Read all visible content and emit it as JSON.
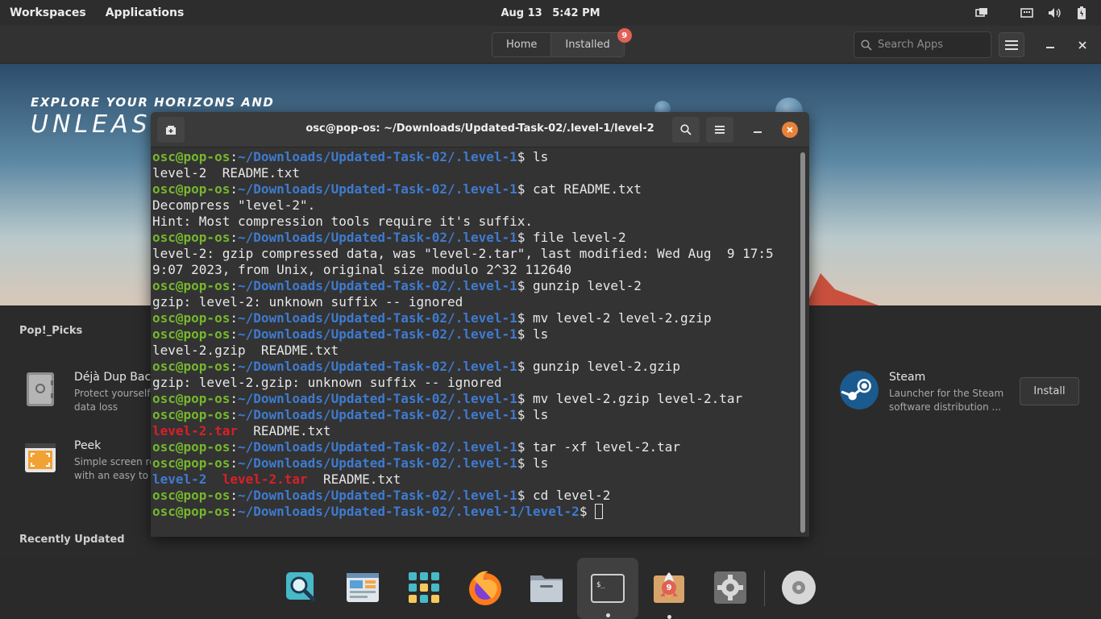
{
  "topbar": {
    "workspaces": "Workspaces",
    "applications": "Applications",
    "date": "Aug 13",
    "time": "5:42 PM"
  },
  "header": {
    "tabs": [
      {
        "label": "Home"
      },
      {
        "label": "Installed",
        "badge": "9"
      }
    ],
    "search_placeholder": "Search Apps"
  },
  "banner": {
    "line1": "EXPLORE YOUR HORIZONS AND",
    "line2": "UNLEASH"
  },
  "sections": {
    "picks_title": "Pop!_Picks",
    "recent_title": "Recently Updated"
  },
  "apps": [
    {
      "name": "Déjà Dup Backu",
      "desc_line1": "Protect yourself",
      "desc_line2": "data loss"
    },
    {
      "name": "Peek",
      "desc_line1": "Simple screen re",
      "desc_line2": "with an easy to u"
    },
    {
      "name": "Steam",
      "desc_line1": "Launcher for the Steam",
      "desc_line2": "software distribution ...",
      "action": "Install"
    }
  ],
  "terminal": {
    "title": "osc@pop-os: ~/Downloads/Updated-Task-02/.level-1/level-2",
    "user": "osc@pop-os",
    "cwd": "~/Downloads/Updated-Task-02/.level-1",
    "cwd_final": "~/Downloads/Updated-Task-02/.level-1/level-2",
    "lines": [
      {
        "type": "prompt",
        "cmd": "ls"
      },
      {
        "type": "out",
        "text": "level-2  README.txt"
      },
      {
        "type": "prompt",
        "cmd": "cat README.txt"
      },
      {
        "type": "out",
        "text": "Decompress \"level-2\"."
      },
      {
        "type": "out",
        "text": "Hint: Most compression tools require it's suffix."
      },
      {
        "type": "prompt",
        "cmd": "file level-2"
      },
      {
        "type": "out",
        "text": "level-2: gzip compressed data, was \"level-2.tar\", last modified: Wed Aug  9 17:5"
      },
      {
        "type": "out",
        "text": "9:07 2023, from Unix, original size modulo 2^32 112640"
      },
      {
        "type": "prompt",
        "cmd": "gunzip level-2"
      },
      {
        "type": "out",
        "text": "gzip: level-2: unknown suffix -- ignored"
      },
      {
        "type": "prompt",
        "cmd": "mv level-2 level-2.gzip"
      },
      {
        "type": "prompt",
        "cmd": "ls"
      },
      {
        "type": "out",
        "text": "level-2.gzip  README.txt"
      },
      {
        "type": "prompt",
        "cmd": "gunzip level-2.gzip"
      },
      {
        "type": "out",
        "text": "gzip: level-2.gzip: unknown suffix -- ignored"
      },
      {
        "type": "prompt",
        "cmd": "mv level-2.gzip level-2.tar"
      },
      {
        "type": "prompt",
        "cmd": "ls"
      },
      {
        "type": "ls",
        "items": [
          {
            "text": "level-2.tar",
            "kind": "arch"
          },
          {
            "text": "README.txt",
            "kind": "file"
          }
        ]
      },
      {
        "type": "prompt",
        "cmd": "tar -xf level-2.tar"
      },
      {
        "type": "prompt",
        "cmd": "ls"
      },
      {
        "type": "ls",
        "items": [
          {
            "text": "level-2",
            "kind": "dir"
          },
          {
            "text": "level-2.tar",
            "kind": "arch"
          },
          {
            "text": "README.txt",
            "kind": "file"
          }
        ]
      },
      {
        "type": "prompt",
        "cmd": "cd level-2"
      },
      {
        "type": "final_prompt"
      }
    ]
  },
  "dock": {
    "items": [
      {
        "icon": "search-icon"
      },
      {
        "icon": "files-browser-icon"
      },
      {
        "icon": "app-grid-icon"
      },
      {
        "icon": "firefox-icon"
      },
      {
        "icon": "file-manager-icon"
      },
      {
        "icon": "terminal-icon",
        "active": true
      },
      {
        "icon": "pop-shop-icon",
        "badge": "9"
      },
      {
        "icon": "settings-icon"
      },
      {
        "icon": "disc-icon"
      }
    ]
  },
  "colors": {
    "prompt_user": "#76b72d",
    "prompt_path": "#3e7bd0",
    "archive": "#d8202a",
    "badge": "#e06155",
    "close": "#e9813a"
  }
}
